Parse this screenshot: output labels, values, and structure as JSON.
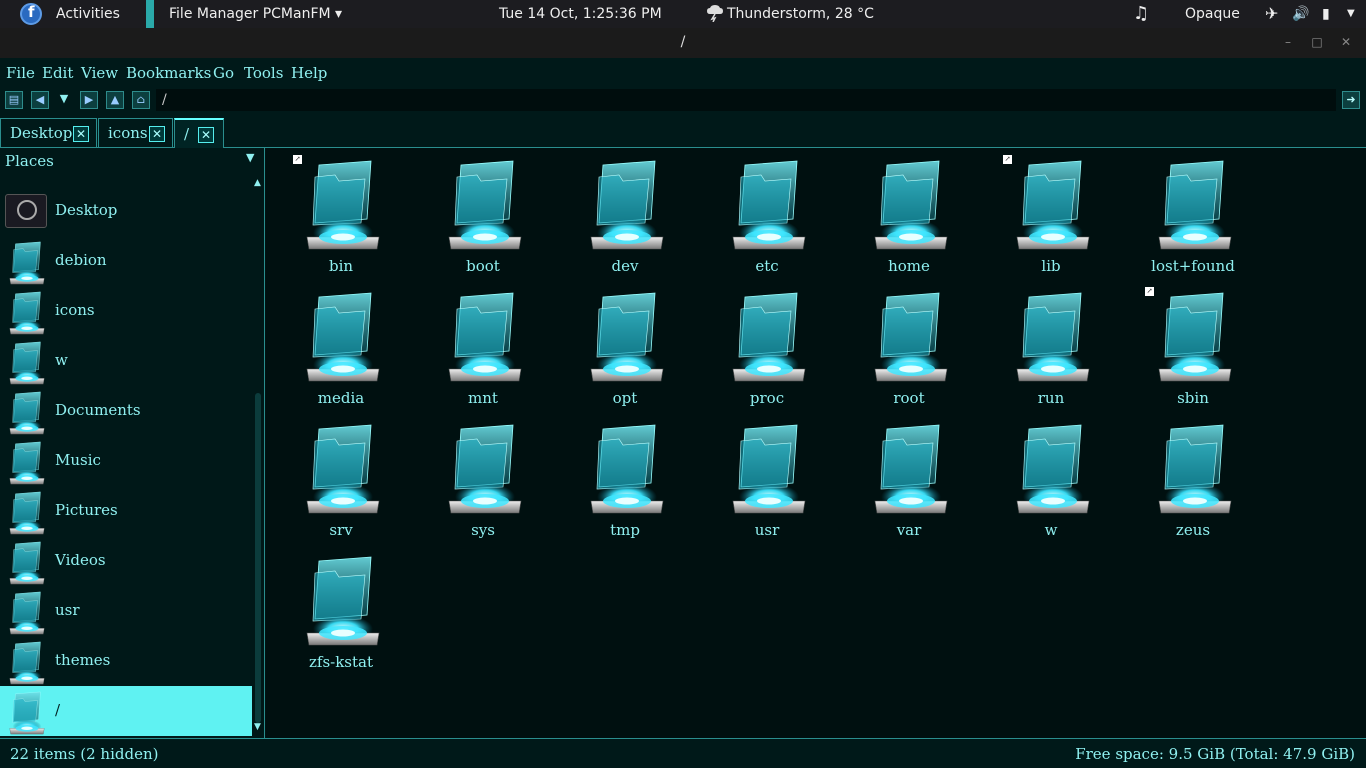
{
  "topbar": {
    "activities": "Activities",
    "app_name": "File Manager PCManFM ▾",
    "clock": "Tue 14 Oct,  1:25:36 PM",
    "weather": "Thunderstorm, 28 °C",
    "theme_label": "Opaque"
  },
  "window": {
    "title": "/",
    "min": "–",
    "max": "□",
    "close": "✕"
  },
  "menu": [
    "File",
    "Edit",
    "View",
    "Bookmarks",
    "Go",
    "Tools",
    "Help"
  ],
  "toolbar": {
    "path": "/",
    "icons": [
      "new-window-icon",
      "back-icon",
      "history-dropdown-icon",
      "forward-icon",
      "up-icon",
      "home-icon"
    ],
    "go_icon": "go-icon"
  },
  "tabs": [
    {
      "label": "Desktop",
      "active": false
    },
    {
      "label": "icons",
      "active": false
    },
    {
      "label": "/",
      "active": true
    }
  ],
  "sidepane": {
    "header": "Places",
    "items": [
      {
        "label": "Desktop",
        "icon": "desktop-icon",
        "selected": false
      },
      {
        "label": "debion",
        "icon": "folder-icon",
        "selected": false
      },
      {
        "label": "icons",
        "icon": "folder-icon",
        "selected": false
      },
      {
        "label": "w",
        "icon": "folder-icon",
        "selected": false
      },
      {
        "label": "Documents",
        "icon": "folder-icon",
        "selected": false
      },
      {
        "label": "Music",
        "icon": "folder-icon",
        "selected": false
      },
      {
        "label": "Pictures",
        "icon": "folder-icon",
        "selected": false
      },
      {
        "label": "Videos",
        "icon": "folder-icon",
        "selected": false
      },
      {
        "label": "usr",
        "icon": "folder-icon",
        "selected": false
      },
      {
        "label": "themes",
        "icon": "folder-icon",
        "selected": false
      },
      {
        "label": "/",
        "icon": "folder-icon",
        "selected": true
      }
    ]
  },
  "files": [
    {
      "name": "bin",
      "link": true
    },
    {
      "name": "boot",
      "link": false
    },
    {
      "name": "dev",
      "link": false
    },
    {
      "name": "etc",
      "link": false
    },
    {
      "name": "home",
      "link": false
    },
    {
      "name": "lib",
      "link": true
    },
    {
      "name": "lost+found",
      "link": false
    },
    {
      "name": "media",
      "link": false
    },
    {
      "name": "mnt",
      "link": false
    },
    {
      "name": "opt",
      "link": false
    },
    {
      "name": "proc",
      "link": false
    },
    {
      "name": "root",
      "link": false
    },
    {
      "name": "run",
      "link": false
    },
    {
      "name": "sbin",
      "link": true
    },
    {
      "name": "srv",
      "link": false
    },
    {
      "name": "sys",
      "link": false
    },
    {
      "name": "tmp",
      "link": false
    },
    {
      "name": "usr",
      "link": false
    },
    {
      "name": "var",
      "link": false
    },
    {
      "name": "w",
      "link": false
    },
    {
      "name": "zeus",
      "link": false
    },
    {
      "name": "zfs-kstat",
      "link": false
    }
  ],
  "status": {
    "items": "22 items (2 hidden)",
    "free_space": "Free space: 9.5 GiB (Total: 47.9 GiB)"
  },
  "colors": {
    "accent": "#5ff2f2",
    "background": "#001010",
    "text": "#8ff0f0"
  }
}
